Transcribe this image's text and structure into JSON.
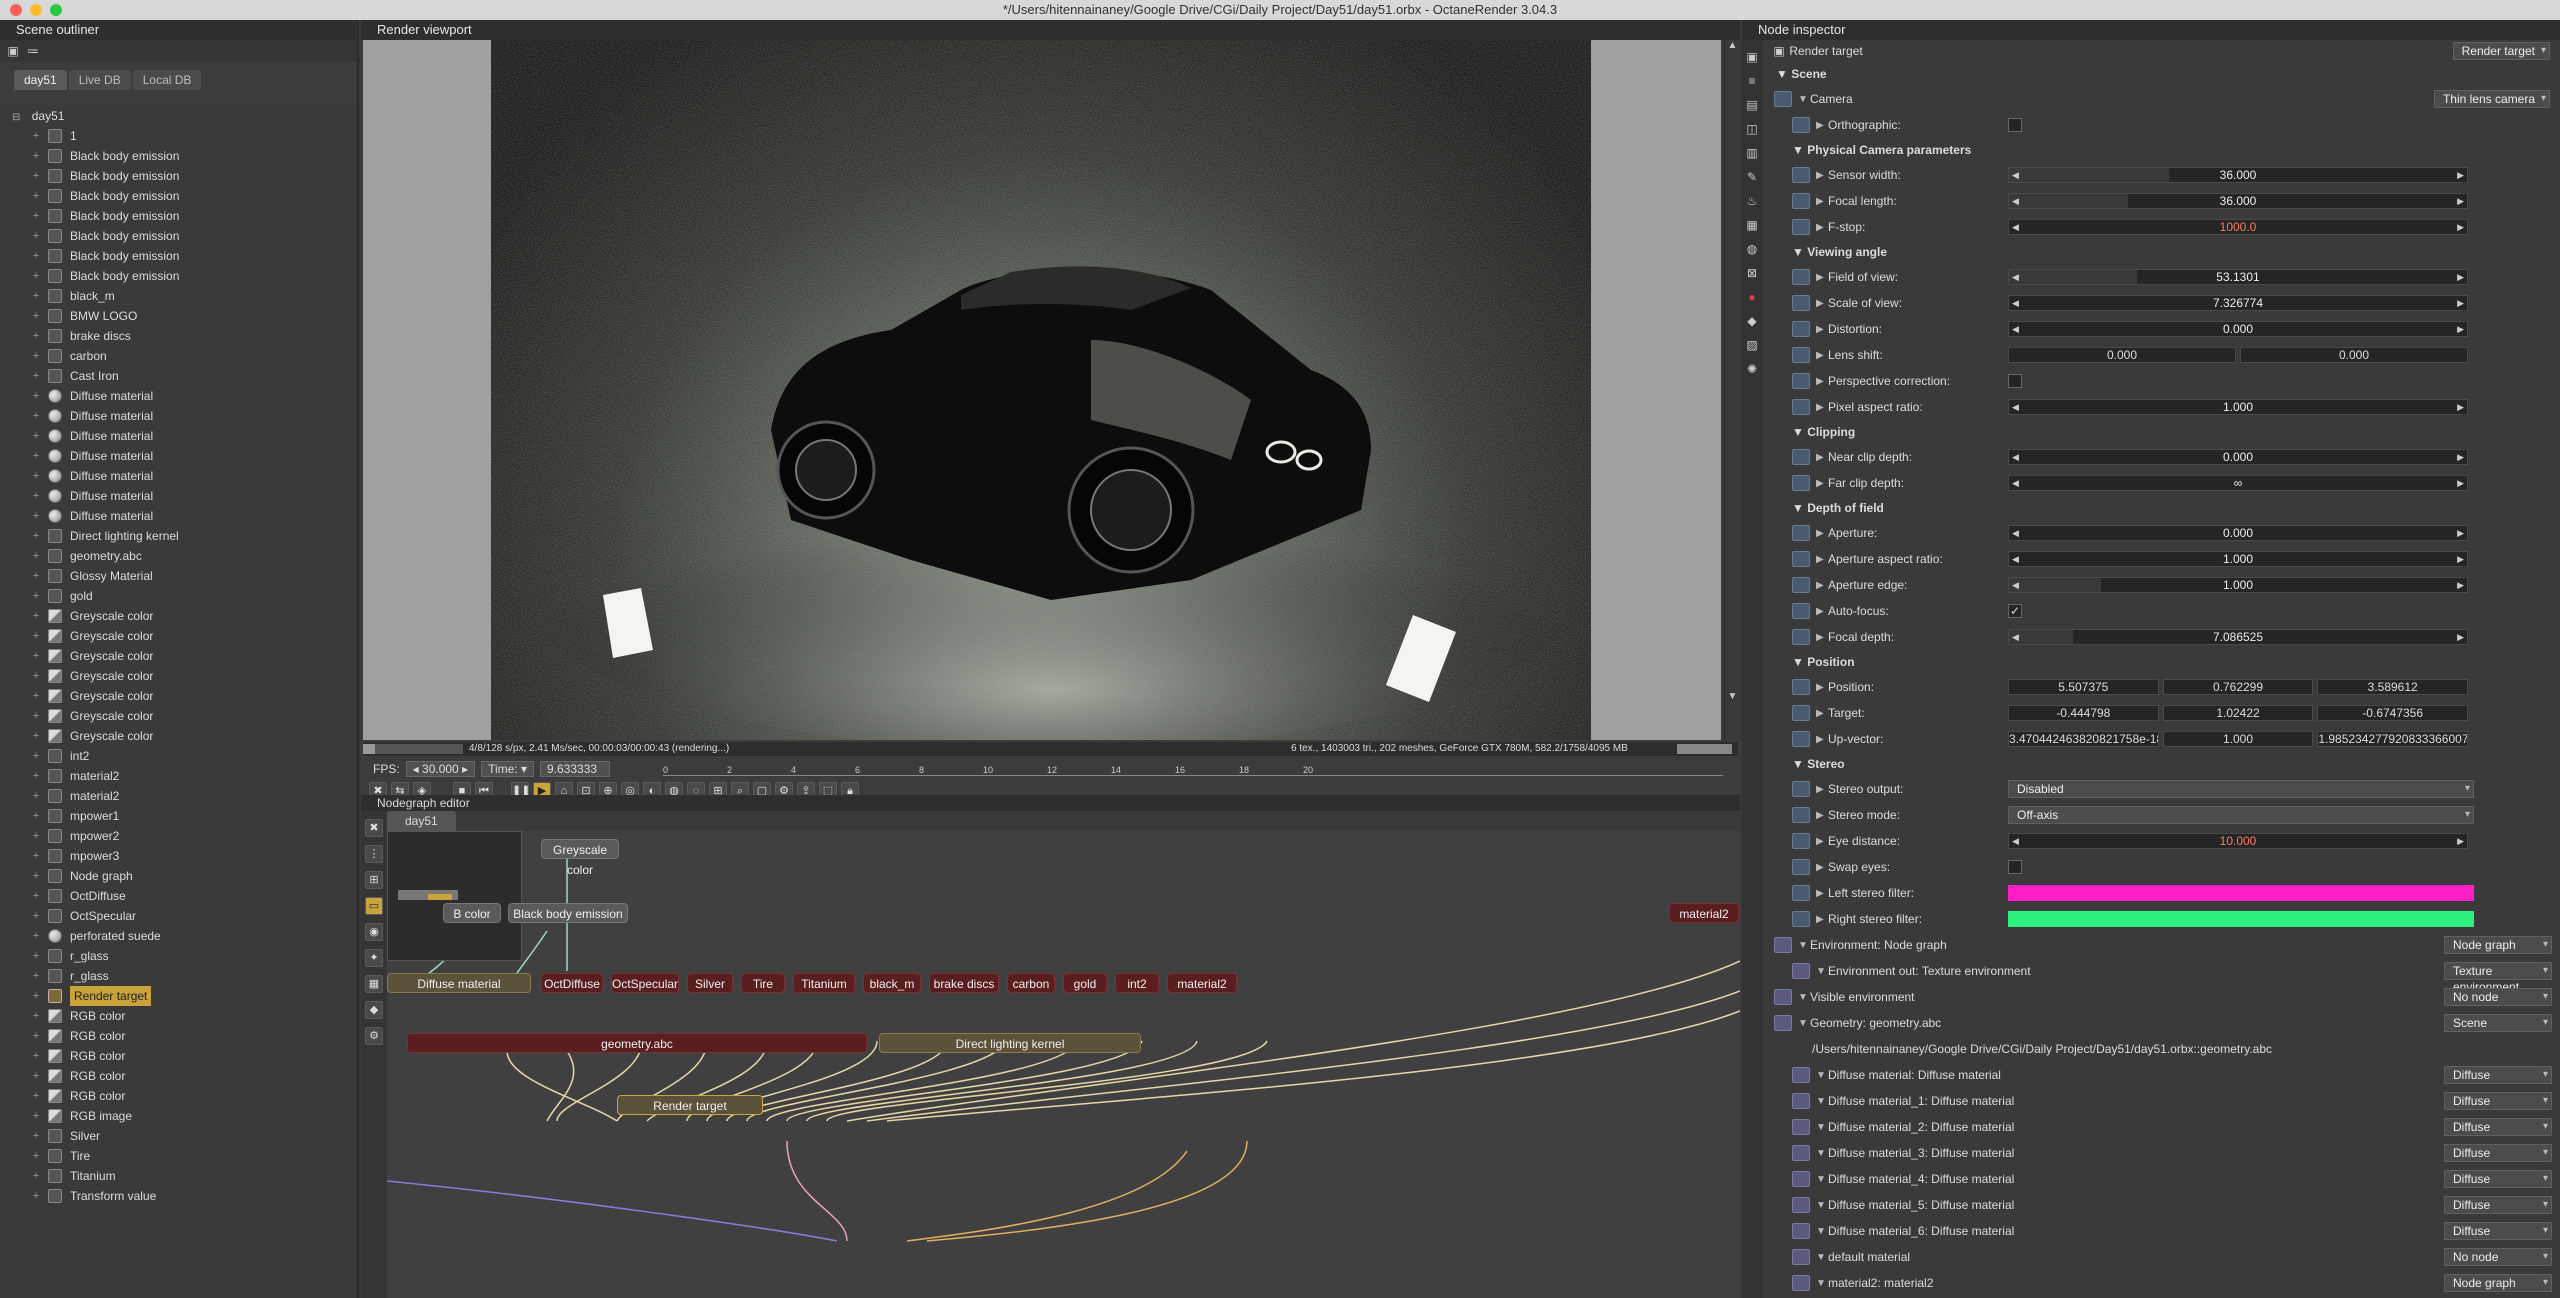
{
  "window": {
    "title": "*/Users/hitennainaney/Google Drive/CGi/Daily Project/Day51/day51.orbx - OctaneRender 3.04.3"
  },
  "outliner": {
    "title": "Scene outliner",
    "tabs": [
      "day51",
      "Live DB",
      "Local DB"
    ],
    "root": "day51",
    "items": [
      {
        "label": "1",
        "icon": "node-icon"
      },
      {
        "label": "Black body emission",
        "icon": "emission-icon"
      },
      {
        "label": "Black body emission",
        "icon": "emission-icon"
      },
      {
        "label": "Black body emission",
        "icon": "emission-icon"
      },
      {
        "label": "Black body emission",
        "icon": "emission-icon"
      },
      {
        "label": "Black body emission",
        "icon": "emission-icon"
      },
      {
        "label": "Black body emission",
        "icon": "emission-icon"
      },
      {
        "label": "Black body emission",
        "icon": "emission-icon"
      },
      {
        "label": "black_m",
        "icon": "node-icon"
      },
      {
        "label": "BMW LOGO",
        "icon": "node-icon"
      },
      {
        "label": "brake discs",
        "icon": "node-icon"
      },
      {
        "label": "carbon",
        "icon": "node-icon"
      },
      {
        "label": "Cast Iron",
        "icon": "node-icon"
      },
      {
        "label": "Diffuse material",
        "icon": "sphere-icon"
      },
      {
        "label": "Diffuse material",
        "icon": "sphere-icon"
      },
      {
        "label": "Diffuse material",
        "icon": "sphere-icon"
      },
      {
        "label": "Diffuse material",
        "icon": "sphere-icon"
      },
      {
        "label": "Diffuse material",
        "icon": "sphere-icon"
      },
      {
        "label": "Diffuse material",
        "icon": "sphere-icon"
      },
      {
        "label": "Diffuse material",
        "icon": "sphere-icon"
      },
      {
        "label": "Direct lighting kernel",
        "icon": "node-icon"
      },
      {
        "label": "geometry.abc",
        "icon": "geometry-icon"
      },
      {
        "label": "Glossy Material",
        "icon": "node-icon"
      },
      {
        "label": "gold",
        "icon": "node-icon"
      },
      {
        "label": "Greyscale color",
        "icon": "texture-icon"
      },
      {
        "label": "Greyscale color",
        "icon": "texture-icon"
      },
      {
        "label": "Greyscale color",
        "icon": "texture-icon"
      },
      {
        "label": "Greyscale color",
        "icon": "texture-icon"
      },
      {
        "label": "Greyscale color",
        "icon": "texture-icon"
      },
      {
        "label": "Greyscale color",
        "icon": "texture-icon"
      },
      {
        "label": "Greyscale color",
        "icon": "texture-icon"
      },
      {
        "label": "int2",
        "icon": "node-icon"
      },
      {
        "label": "material2",
        "icon": "node-icon"
      },
      {
        "label": "material2",
        "icon": "node-icon"
      },
      {
        "label": "mpower1",
        "icon": "node-icon"
      },
      {
        "label": "mpower2",
        "icon": "node-icon"
      },
      {
        "label": "mpower3",
        "icon": "node-icon"
      },
      {
        "label": "Node graph",
        "icon": "node-icon"
      },
      {
        "label": "OctDiffuse",
        "icon": "node-icon"
      },
      {
        "label": "OctSpecular",
        "icon": "node-icon"
      },
      {
        "label": "perforated suede",
        "icon": "sphere-icon"
      },
      {
        "label": "r_glass",
        "icon": "node-icon"
      },
      {
        "label": "r_glass",
        "icon": "node-icon"
      },
      {
        "label": "Render target",
        "icon": "render-target-icon",
        "selected": true
      },
      {
        "label": "RGB color",
        "icon": "texture-icon"
      },
      {
        "label": "RGB color",
        "icon": "texture-icon"
      },
      {
        "label": "RGB color",
        "icon": "texture-icon"
      },
      {
        "label": "RGB color",
        "icon": "texture-icon"
      },
      {
        "label": "RGB color",
        "icon": "texture-icon"
      },
      {
        "label": "RGB image",
        "icon": "texture-icon"
      },
      {
        "label": "Silver",
        "icon": "node-icon"
      },
      {
        "label": "Tire",
        "icon": "node-icon"
      },
      {
        "label": "Titanium",
        "icon": "node-icon"
      },
      {
        "label": "Transform value",
        "icon": "node-icon"
      }
    ]
  },
  "viewport": {
    "title": "Render viewport",
    "status_left": "4/8/128 s/px, 2.41 Ms/sec, 00:00:03/00:00:43 (rendering...)",
    "status_right": "6 tex., 1403003 tri., 202 meshes, GeForce GTX 780M, 582.2/1758/4095 MB",
    "fps_label": "FPS:",
    "fps_value": "30.000",
    "time_label": "Time:",
    "time_value": "9.633333",
    "ruler_ticks": [
      "0",
      "2",
      "4",
      "6",
      "8",
      "10",
      "12",
      "14",
      "16",
      "18",
      "20"
    ]
  },
  "nodegraph": {
    "title": "Nodegraph editor",
    "tab": "day51",
    "nodes": {
      "greyscale": "Greyscale color",
      "rgb_partial": "B color",
      "blackbody": "Black body emission",
      "material2_top": "material2",
      "diffuse": "Diffuse material",
      "octdiffuse": "OctDiffuse",
      "octspecular": "OctSpecular",
      "silver": "Silver",
      "tire": "Tire",
      "titanium": "Titanium",
      "black_m": "black_m",
      "brake": "brake discs",
      "carbon": "carbon",
      "gold": "gold",
      "int2": "int2",
      "material2": "material2",
      "geometry": "geometry.abc",
      "kernel": "Direct lighting kernel",
      "render_target": "Render target"
    }
  },
  "inspector": {
    "title": "Node inspector",
    "header_name": "Render target",
    "header_combo": "Render target",
    "scene_label": "Scene",
    "camera_label": "Camera",
    "camera_combo": "Thin lens camera",
    "orthographic": "Orthographic:",
    "sections": {
      "physical": "Physical Camera parameters",
      "viewing": "Viewing angle",
      "clipping": "Clipping",
      "dof": "Depth of field",
      "position": "Position",
      "stereo": "Stereo"
    },
    "params": {
      "sensor_width": {
        "label": "Sensor width:",
        "value": "36.000"
      },
      "focal_length": {
        "label": "Focal length:",
        "value": "36.000"
      },
      "fstop": {
        "label": "F-stop:",
        "value": "1000.0"
      },
      "fov": {
        "label": "Field of view:",
        "value": "53.1301"
      },
      "scale_of_view": {
        "label": "Scale of view:",
        "value": "7.326774"
      },
      "distortion": {
        "label": "Distortion:",
        "value": "0.000"
      },
      "lens_shift": {
        "label": "Lens shift:",
        "value_a": "0.000",
        "value_b": "0.000"
      },
      "perspective": {
        "label": "Perspective correction:"
      },
      "pixel_aspect": {
        "label": "Pixel aspect ratio:",
        "value": "1.000"
      },
      "near_clip": {
        "label": "Near clip depth:",
        "value": "0.000"
      },
      "far_clip": {
        "label": "Far clip depth:",
        "value": "∞"
      },
      "aperture": {
        "label": "Aperture:",
        "value": "0.000"
      },
      "aperture_ratio": {
        "label": "Aperture aspect ratio:",
        "value": "1.000"
      },
      "aperture_edge": {
        "label": "Aperture edge:",
        "value": "1.000"
      },
      "autofocus": {
        "label": "Auto-focus:",
        "value": "✓"
      },
      "focal_depth": {
        "label": "Focal depth:",
        "value": "7.086525"
      },
      "position": {
        "label": "Position:",
        "x": "5.507375",
        "y": "0.762299",
        "z": "3.589612"
      },
      "target": {
        "label": "Target:",
        "x": "-0.444798",
        "y": "1.02422",
        "z": "-0.6747356"
      },
      "up_vector": {
        "label": "Up-vector:",
        "x": "3.470442463820821758e-18",
        "y": "1.000",
        "z": "1.985234277920833366007e-21"
      },
      "stereo_output": {
        "label": "Stereo output:",
        "value": "Disabled"
      },
      "stereo_mode": {
        "label": "Stereo mode:",
        "value": "Off-axis"
      },
      "eye_distance": {
        "label": "Eye distance:",
        "value": "10.000"
      },
      "swap_eyes": {
        "label": "Swap eyes:"
      },
      "left_filter": {
        "label": "Left stereo filter:",
        "color": "#ff1fc8"
      },
      "right_filter": {
        "label": "Right stereo filter:",
        "color": "#2ef07e"
      }
    },
    "environment": {
      "label": "Environment: Node graph",
      "combo": "Node graph"
    },
    "environment_out": {
      "label": "Environment out: Texture environment",
      "combo": "Texture environment"
    },
    "visible_env": {
      "label": "Visible environment",
      "combo": "No node"
    },
    "geometry": {
      "label": "Geometry: geometry.abc",
      "combo": "Scene"
    },
    "geometry_path": "/Users/hitennainaney/Google Drive/CGi/Daily Project/Day51/day51.orbx::geometry.abc",
    "materials": [
      {
        "label": "Diffuse material: Diffuse material",
        "combo": "Diffuse"
      },
      {
        "label": "Diffuse material_1: Diffuse material",
        "combo": "Diffuse"
      },
      {
        "label": "Diffuse material_2: Diffuse material",
        "combo": "Diffuse"
      },
      {
        "label": "Diffuse material_3: Diffuse material",
        "combo": "Diffuse"
      },
      {
        "label": "Diffuse material_4: Diffuse material",
        "combo": "Diffuse"
      },
      {
        "label": "Diffuse material_5: Diffuse material",
        "combo": "Diffuse"
      },
      {
        "label": "Diffuse material_6: Diffuse material",
        "combo": "Diffuse"
      },
      {
        "label": "default material",
        "combo": "No node"
      },
      {
        "label": "material2: material2",
        "combo": "Node graph"
      }
    ]
  },
  "colors": {
    "accent": "#c9a43a",
    "fstop_value": "#ff7a5a",
    "eye_distance_value": "#ff7a5a"
  }
}
